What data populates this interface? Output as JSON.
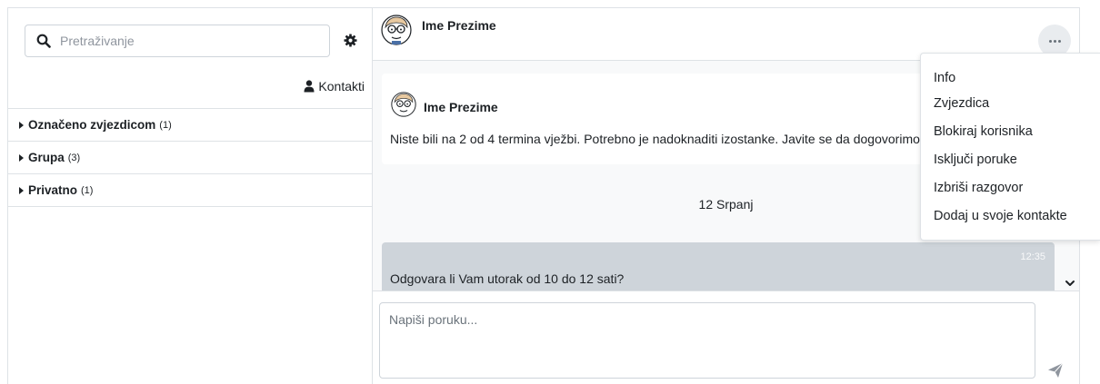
{
  "search": {
    "placeholder": "Pretraživanje"
  },
  "contacts_link": {
    "label": "Kontakti"
  },
  "sections": [
    {
      "label": "Označeno zvjezdicom",
      "count": "(1)"
    },
    {
      "label": "Grupa",
      "count": "(3)"
    },
    {
      "label": "Privatno",
      "count": "(1)"
    }
  ],
  "conversation": {
    "header_name": "Ime Prezime",
    "intro": {
      "name": "Ime Prezime",
      "text": "Niste bili na 2 od 4 termina vježbi. Potrebno je nadoknaditi izostanke. Javite se da dogovorimo novi termin"
    },
    "date_separator": "12 Srpanj",
    "messages": [
      {
        "time": "12:35",
        "text": "Odgovara li Vam utorak od 10 do 12 sati?"
      }
    ]
  },
  "compose": {
    "placeholder": "Napiši poruku..."
  },
  "menu": {
    "items": [
      "Info",
      "Zvjezdica",
      "Blokiraj korisnika",
      "Isključi poruke",
      "Izbriši razgovor",
      "Dodaj u svoje kontakte"
    ]
  },
  "colors": {
    "border": "#dee2e6",
    "messages_bg": "#f8f9fa",
    "bubble_bg": "#ced4da",
    "text": "#1d2125"
  }
}
